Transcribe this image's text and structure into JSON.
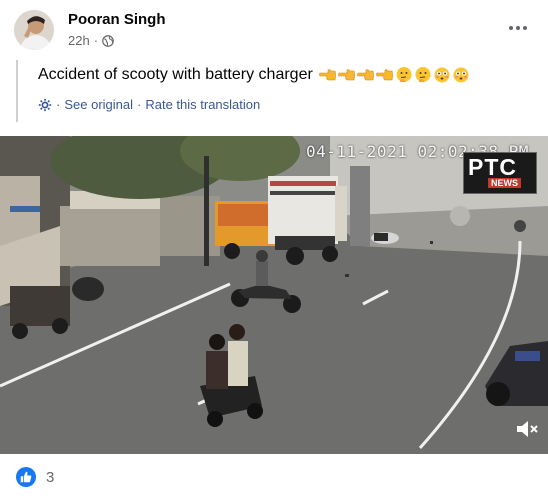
{
  "post": {
    "author": "Pooran Singh",
    "time": "22h",
    "separator": "·",
    "privacy_icon": "globe-icon"
  },
  "translation": {
    "text": "Accident of scooty with battery charger",
    "emojis": [
      "backhand-index-pointing-left",
      "backhand-index-pointing-left",
      "backhand-index-pointing-left",
      "backhand-index-pointing-left",
      "thinking-face",
      "thinking-face",
      "flushed-face",
      "flushed-face"
    ],
    "see_original": "See original",
    "dot": "·",
    "rate": "Rate this translation"
  },
  "video": {
    "timestamp": "04-11-2021  02:02:38 PM",
    "logo_big": "PTC",
    "logo_small": "NEWS"
  },
  "reactions": {
    "icon": "like-icon",
    "count": "3"
  }
}
